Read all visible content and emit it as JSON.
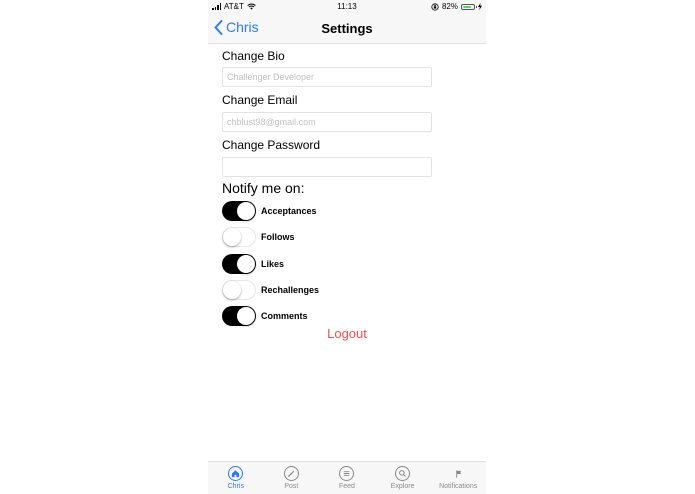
{
  "status_bar": {
    "carrier": "AT&T",
    "time": "11:13",
    "battery": "82%",
    "battery_level": 0.82,
    "colors": {
      "battery_fill": "#4cd964"
    }
  },
  "nav": {
    "back_label": "Chris",
    "title": "Settings"
  },
  "form": {
    "bio": {
      "label": "Change Bio",
      "placeholder": "Challenger Developer",
      "value": ""
    },
    "email": {
      "label": "Change Email",
      "placeholder": "chblust98@gmail.com",
      "value": ""
    },
    "password": {
      "label": "Change Password",
      "placeholder": "",
      "value": ""
    }
  },
  "notify": {
    "title": "Notify me on:",
    "items": [
      {
        "label": "Acceptances",
        "on": true
      },
      {
        "label": "Follows",
        "on": false
      },
      {
        "label": "Likes",
        "on": true
      },
      {
        "label": "Rechallenges",
        "on": false
      },
      {
        "label": "Comments",
        "on": true
      }
    ]
  },
  "logout_label": "Logout",
  "tabs": [
    {
      "label": "Chris",
      "icon": "home-icon",
      "active": true
    },
    {
      "label": "Post",
      "icon": "pen-icon",
      "active": false
    },
    {
      "label": "Feed",
      "icon": "list-icon",
      "active": false
    },
    {
      "label": "Explore",
      "icon": "search-icon",
      "active": false
    },
    {
      "label": "Notifications",
      "icon": "flag-icon",
      "active": false
    }
  ],
  "colors": {
    "accent": "#2f7bf5",
    "logout": "#e8524e",
    "toggle_on": "#000000"
  }
}
